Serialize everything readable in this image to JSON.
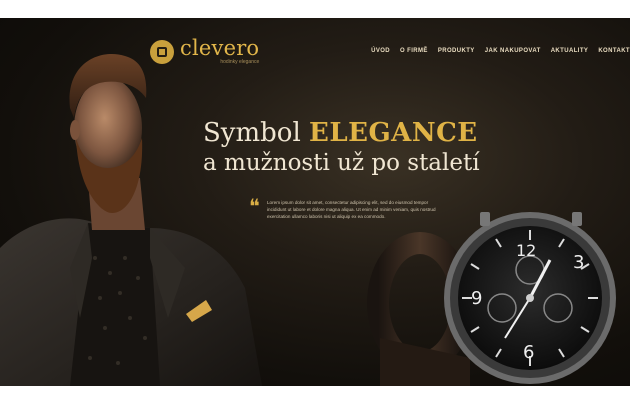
{
  "brand": {
    "name": "clevero",
    "tagline": "hodinky elegance"
  },
  "nav": {
    "items": [
      "ÚVOD",
      "O FIRMĚ",
      "PRODUKTY",
      "JAK NAKUPOVAT",
      "AKTUALITY",
      "KONTAKT"
    ]
  },
  "hero": {
    "headline_prefix": "Symbol ",
    "headline_accent": "ELEGANCE",
    "headline_line2": "a mužnosti už po staletí",
    "quote_text": "Lorem ipsum dolor sit amet, consectetur adipiscing elit, sed do eiusmod tempor incididunt ut labore et dolore magna aliqua. Ut enim ad minim veniam, quis nostrud exercitation ullamco laboris nisi ut aliquip ex ea commodo."
  },
  "watch": {
    "dial_numbers": [
      "3",
      "6",
      "9",
      "12"
    ]
  },
  "colors": {
    "accent_gold": "#e0b346",
    "background_dark": "#120f0b",
    "text_light": "#f0e6d2"
  }
}
